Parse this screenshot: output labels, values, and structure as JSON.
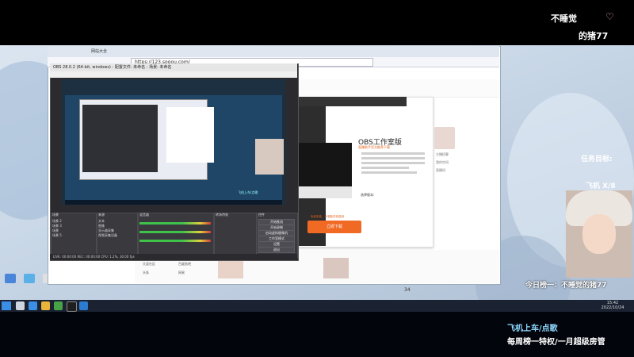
{
  "overlay": {
    "title_line1": "不睡觉",
    "title_line2": "的猪77",
    "task_label": "任务目标:",
    "task_value": "飞机 X/8",
    "rank_text": "今日榜一：不睡觉的猪77",
    "bottom_line1": "飞机上车/点歌",
    "bottom_line2": "每周榜一特权/一月超级房管"
  },
  "browser": {
    "tab_title": "网站大全",
    "url": "https://123.sogou.com/"
  },
  "obs": {
    "window_title": "OBS 28.0.2 (64-bit, windows) - 配置文件: 未命名 - 场景: 未命名",
    "preview_caption": "飞机上车/点歌",
    "docks": {
      "scenes_header": "场景",
      "sources_header": "来源",
      "mixer_header": "混音器",
      "transitions_header": "转场特效",
      "controls_header": "控件"
    },
    "scenes": [
      "场景 2",
      "场景 3",
      "场景",
      "场景 5"
    ],
    "sources": [
      "文本",
      "图像",
      "显示器采集",
      "视频采集设备"
    ],
    "controls": [
      "开始推流",
      "开始录制",
      "启动虚拟摄像机",
      "工作室模式",
      "设置",
      "退出"
    ],
    "status": "LIVE: 00:00:00   REC: 00:00:00   CPU: 1.2%, 30.00 fps"
  },
  "site": {
    "dialog_title": "OBS工作室版",
    "dialog_sub": "直播助手官方推荐下载",
    "install_button": "立即下载",
    "install_note": "免费安装，不收取任何费用",
    "dialog_label": "选择版本:",
    "side_links": [
      "主播招募",
      "我的空间",
      "直播间"
    ]
  },
  "bottom_links": [
    "天涯社区",
    "百度贴吧",
    "头条",
    "网易"
  ],
  "clock": {
    "time": "15:42",
    "date": "2022/10/24"
  },
  "side_number": "34"
}
